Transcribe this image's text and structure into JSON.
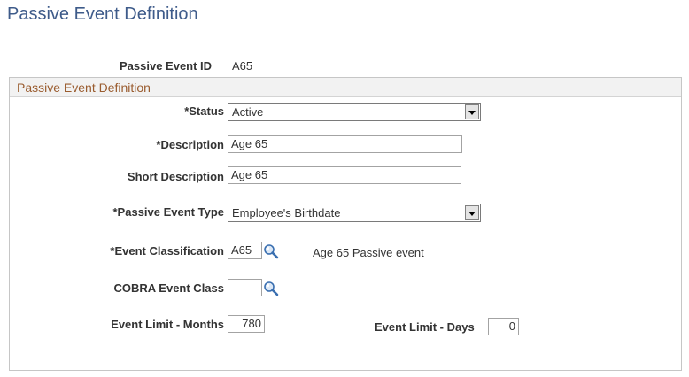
{
  "page": {
    "title": "Passive Event Definition",
    "passive_event_id_label": "Passive Event ID",
    "passive_event_id_value": "A65"
  },
  "group": {
    "title": "Passive Event Definition",
    "status": {
      "label": "*Status",
      "value": "Active"
    },
    "description": {
      "label": "*Description",
      "value": "Age 65"
    },
    "short_description": {
      "label": "Short Description",
      "value": "Age 65"
    },
    "passive_event_type": {
      "label": "*Passive Event Type",
      "value": "Employee's Birthdate"
    },
    "event_classification": {
      "label": "*Event Classification",
      "value": "A65",
      "description": "Age 65 Passive event"
    },
    "cobra_event_class": {
      "label": "COBRA Event Class",
      "value": ""
    },
    "event_limit_months": {
      "label": "Event Limit - Months",
      "value": "780"
    },
    "event_limit_days": {
      "label": "Event Limit - Days",
      "value": "0"
    }
  },
  "icons": {
    "lookup": "magnifier-lookup-icon",
    "dropdown": "dropdown-arrow-icon"
  }
}
